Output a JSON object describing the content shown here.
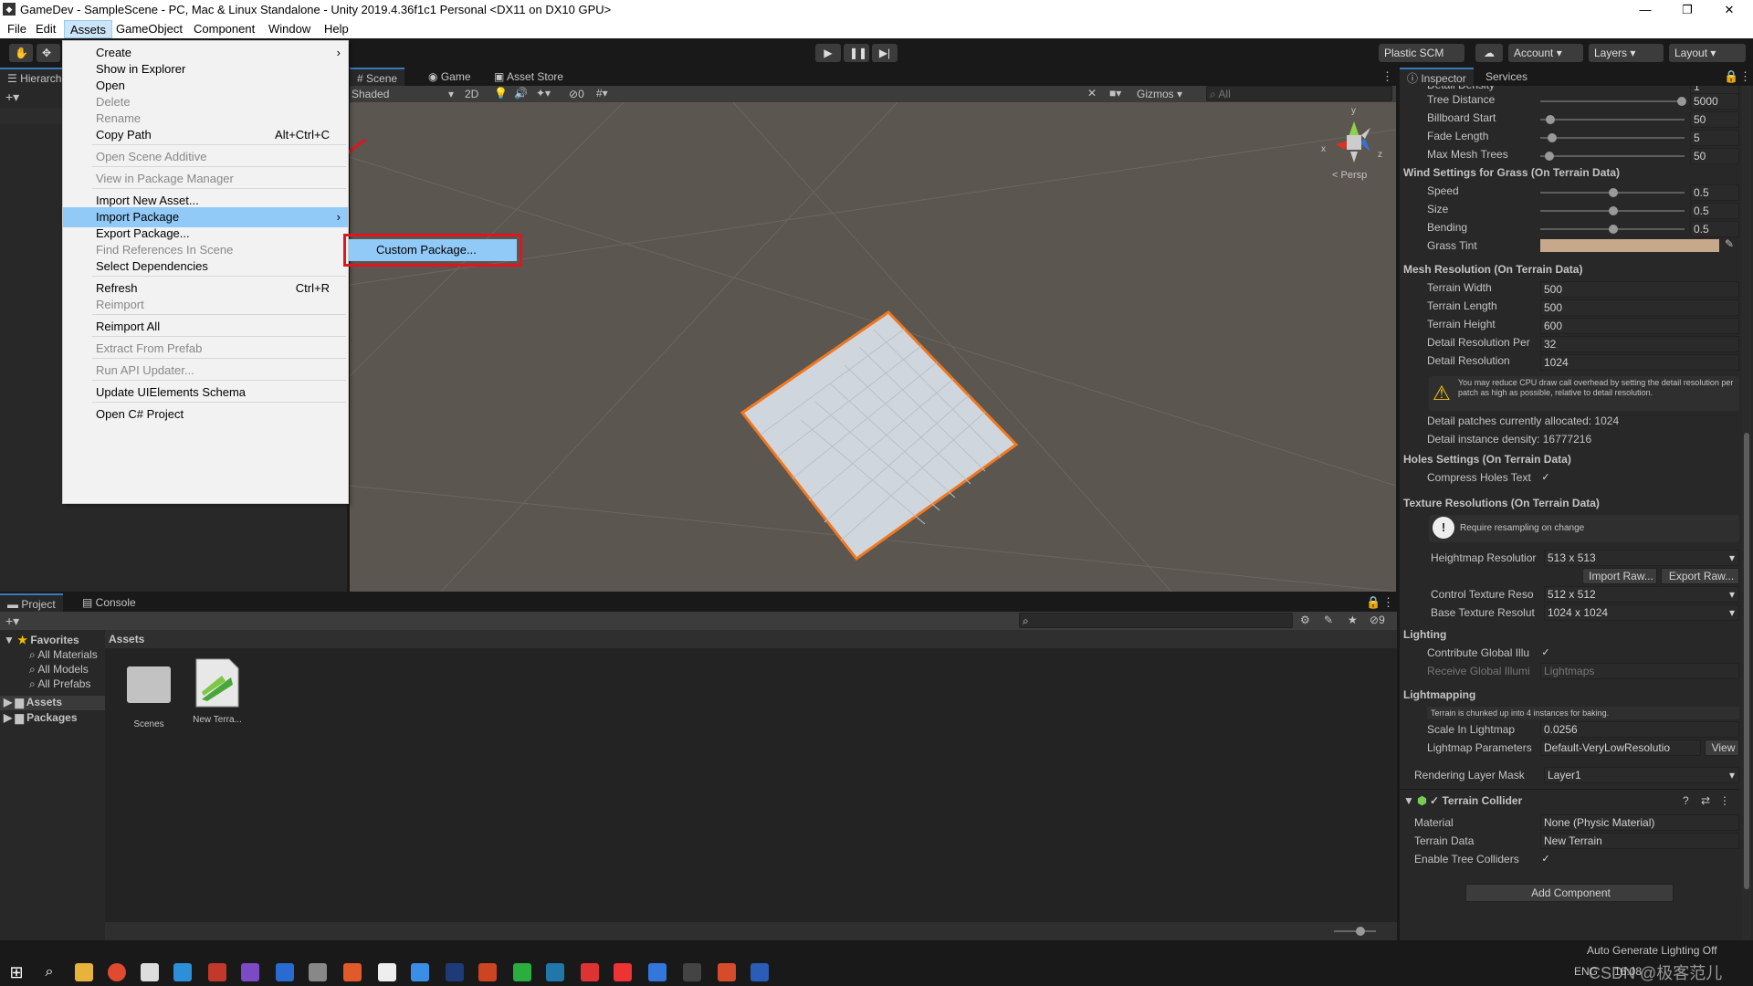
{
  "window": {
    "title": "GameDev - SampleScene - PC, Mac & Linux Standalone - Unity 2019.4.36f1c1 Personal <DX11 on DX10 GPU>",
    "minimize": "—",
    "maximize": "❐",
    "close": "✕"
  },
  "menubar": [
    "File",
    "Edit",
    "Assets",
    "GameObject",
    "Component",
    "Window",
    "Help"
  ],
  "toolbar": {
    "plastic": "Plastic SCM",
    "account": "Account",
    "layers": "Layers",
    "layout": "Layout"
  },
  "context_menu": {
    "items": [
      {
        "label": "Create",
        "arrow": "›"
      },
      {
        "label": "Show in Explorer"
      },
      {
        "label": "Open"
      },
      {
        "label": "Delete",
        "disabled": true
      },
      {
        "label": "Rename",
        "disabled": true
      },
      {
        "label": "Copy Path",
        "shortcut": "Alt+Ctrl+C"
      },
      {
        "label": "Open Scene Additive",
        "disabled": true
      },
      {
        "label": "View in Package Manager",
        "disabled": true
      },
      {
        "label": "Import New Asset..."
      },
      {
        "label": "Import Package",
        "arrow": "›"
      },
      {
        "label": "Export Package..."
      },
      {
        "label": "Find References In Scene",
        "disabled": true
      },
      {
        "label": "Select Dependencies"
      },
      {
        "label": "Refresh",
        "shortcut": "Ctrl+R"
      },
      {
        "label": "Reimport",
        "disabled": true
      },
      {
        "label": "Reimport All"
      },
      {
        "label": "Extract From Prefab",
        "disabled": true
      },
      {
        "label": "Run API Updater...",
        "disabled": true
      },
      {
        "label": "Update UIElements Schema"
      },
      {
        "label": "Open C# Project"
      }
    ],
    "submenu": "Custom Package..."
  },
  "hierarchy": {
    "tab": "Hierarch"
  },
  "scene": {
    "tabs": [
      "Scene",
      "Game",
      "Asset Store"
    ],
    "shading": "Shaded",
    "mode2d": "2D",
    "fx_count": "0",
    "gizmos": "Gizmos",
    "search": "All",
    "persp": "Persp",
    "axis_x": "x",
    "axis_y": "y",
    "axis_z": "z"
  },
  "inspector": {
    "tabs": [
      "Inspector",
      "Services"
    ],
    "rows_top": [
      {
        "label": "Detail Density",
        "value": "1"
      },
      {
        "label": "Tree Distance",
        "value": "5000",
        "pos": 1.0
      },
      {
        "label": "Billboard Start",
        "value": "50",
        "pos": 0.04
      },
      {
        "label": "Fade Length",
        "value": "5",
        "pos": 0.05
      },
      {
        "label": "Max Mesh Trees",
        "value": "50",
        "pos": 0.03
      }
    ],
    "wind_title": "Wind Settings for Grass (On Terrain Data)",
    "wind_rows": [
      {
        "label": "Speed",
        "value": "0.5",
        "pos": 0.5
      },
      {
        "label": "Size",
        "value": "0.5",
        "pos": 0.5
      },
      {
        "label": "Bending",
        "value": "0.5",
        "pos": 0.5
      }
    ],
    "grass_tint": {
      "label": "Grass Tint",
      "color": "#c8a88a"
    },
    "mesh_title": "Mesh Resolution (On Terrain Data)",
    "mesh_rows": [
      {
        "label": "Terrain Width",
        "value": "500"
      },
      {
        "label": "Terrain Length",
        "value": "500"
      },
      {
        "label": "Terrain Height",
        "value": "600"
      },
      {
        "label": "Detail Resolution Per",
        "value": "32"
      },
      {
        "label": "Detail Resolution",
        "value": "1024"
      }
    ],
    "warning": "You may reduce CPU draw call overhead by setting the detail resolution per patch as high as possible, relative to detail resolution.",
    "patches": "Detail patches currently allocated: 1024",
    "density": "Detail instance density: 16777216",
    "holes_title": "Holes Settings (On Terrain Data)",
    "holes_row": "Compress Holes Text",
    "texres_title": "Texture Resolutions (On Terrain Data)",
    "resample": "Require resampling on change",
    "heightmap": {
      "label": "Heightmap Resolutior",
      "value": "513 x 513"
    },
    "import_raw": "Import Raw...",
    "export_raw": "Export Raw...",
    "control": {
      "label": "Control Texture Reso",
      "value": "512 x 512"
    },
    "base": {
      "label": "Base Texture Resolut",
      "value": "1024 x 1024"
    },
    "lighting_title": "Lighting",
    "contribute": "Contribute Global Illu",
    "receive": {
      "label": "Receive Global Illumi",
      "value": "Lightmaps"
    },
    "lightmapping_title": "Lightmapping",
    "chunk_note": "Terrain is chunked up into 4 instances for baking.",
    "scale": {
      "label": "Scale In Lightmap",
      "value": "0.0256"
    },
    "params": {
      "label": "Lightmap Parameters",
      "value": "Default-VeryLowResolutio",
      "view": "View"
    },
    "mask": {
      "label": "Rendering Layer Mask",
      "value": "Layer1"
    },
    "collider_title": "Terrain Collider",
    "material": {
      "label": "Material",
      "value": "None (Physic Material)"
    },
    "tdata": {
      "label": "Terrain Data",
      "value": "New Terrain"
    },
    "trees": "Enable Tree Colliders",
    "add_component": "Add Component"
  },
  "project": {
    "tabs": [
      "Project",
      "Console"
    ],
    "favorites": "Favorites",
    "fav_items": [
      "All Materials",
      "All Models",
      "All Prefabs"
    ],
    "tree": [
      "Assets",
      "Packages"
    ],
    "breadcrumb": "Assets",
    "assets": [
      {
        "name": "Scenes"
      },
      {
        "name": "New Terra..."
      }
    ],
    "count": "9"
  },
  "status": {
    "lighting": "Auto Generate Lighting Off"
  },
  "taskbar": {
    "lang": "ENG",
    "time": "16:08",
    "watermark": "CSDN @极客范儿"
  },
  "colors": {
    "accent": "#3a79bb",
    "highlight_box": "#e0151d",
    "arrow": "#e0151d",
    "selection": "#91c9f7"
  }
}
